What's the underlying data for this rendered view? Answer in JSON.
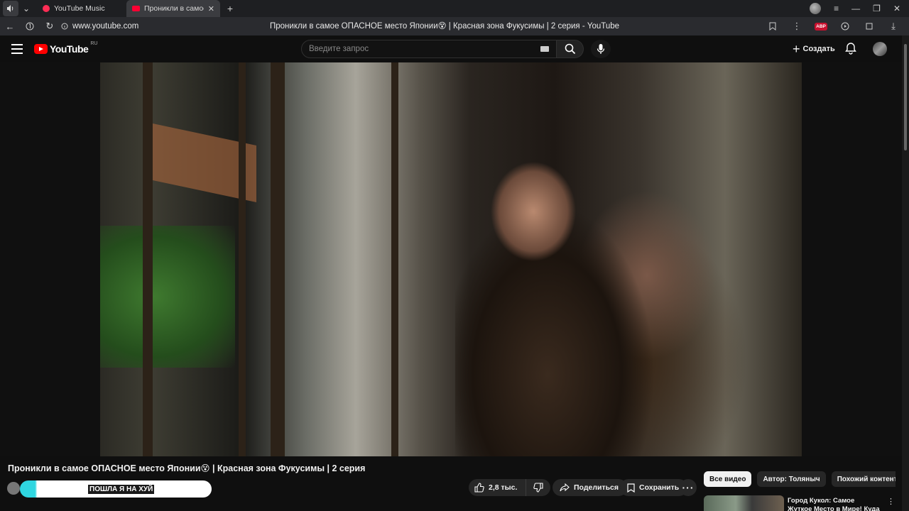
{
  "browser": {
    "tabs": [
      {
        "title": "YouTube Music"
      },
      {
        "title": "Проникли в самое ОПАСНОЕ место Японии"
      }
    ],
    "url": "www.youtube.com",
    "page_title": "Проникли в самое ОПАСНОЕ место Японии😵 | Красная зона Фукусимы | 2 серия - YouTube",
    "abp_label": "ABP"
  },
  "masthead": {
    "logo_text": "YouTube",
    "country": "RU",
    "search_placeholder": "Введите запрос",
    "create_label": "Создать"
  },
  "video": {
    "title": "Проникли в самое ОПАСНОЕ место Японии😵 | Красная зона Фукусимы | 2 серия",
    "overlay_text": "ПОШЛА Я НА ХУЙ",
    "like_count": "2,8 тыс.",
    "share_label": "Поделиться",
    "save_label": "Сохранить"
  },
  "sidebar": {
    "chips": [
      "Все видео",
      "Автор: Толяныч",
      "Похожий контент"
    ],
    "rec_title": "Город Кукол: Самое Жуткое Место в Мире! Куда Пропали"
  },
  "colors": {
    "accent": "#ff0000",
    "background": "#0f0f0f",
    "pill": "#272727",
    "overlay_cyan": "#2fd6e0"
  }
}
